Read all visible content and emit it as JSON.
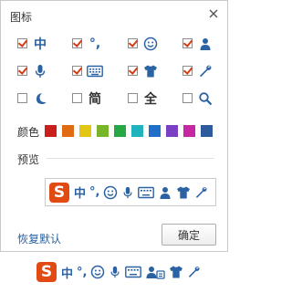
{
  "panel": {
    "title": "图标",
    "colors_label": "颜色",
    "preview_label": "预览",
    "restore_label": "恢复默认",
    "confirm_label": "确定"
  },
  "options": [
    {
      "icon": "chinese-mode-icon",
      "glyph": "中",
      "checked": true
    },
    {
      "icon": "punctuation-icon",
      "glyph": "°,",
      "checked": true
    },
    {
      "icon": "emoji-icon",
      "glyph": "☺",
      "checked": true
    },
    {
      "icon": "user-icon",
      "glyph": "user",
      "checked": true
    },
    {
      "icon": "microphone-icon",
      "glyph": "mic",
      "checked": true
    },
    {
      "icon": "keyboard-icon",
      "glyph": "kbd",
      "checked": true
    },
    {
      "icon": "skin-icon",
      "glyph": "shirt",
      "checked": true
    },
    {
      "icon": "wrench-icon",
      "glyph": "wrench",
      "checked": true
    },
    {
      "icon": "half-width-icon",
      "glyph": "moon",
      "checked": false
    },
    {
      "icon": "simplified-icon",
      "glyph": "简",
      "checked": false
    },
    {
      "icon": "full-width-icon",
      "glyph": "全",
      "checked": false
    },
    {
      "icon": "search-icon",
      "glyph": "search",
      "checked": false
    }
  ],
  "swatches": [
    "#c9201c",
    "#e06b12",
    "#e3c613",
    "#79b52a",
    "#25a845",
    "#1fb3bd",
    "#1f6fc9",
    "#7a3fc2",
    "#c628a4",
    "#2f5a9c"
  ],
  "colors": {
    "accent": "#2a62a3",
    "logo": "#e24a14",
    "check": "#d23c10"
  },
  "preview_icons": [
    "中",
    "°,"
  ],
  "toolbar_icons": [
    "中",
    "°,"
  ]
}
